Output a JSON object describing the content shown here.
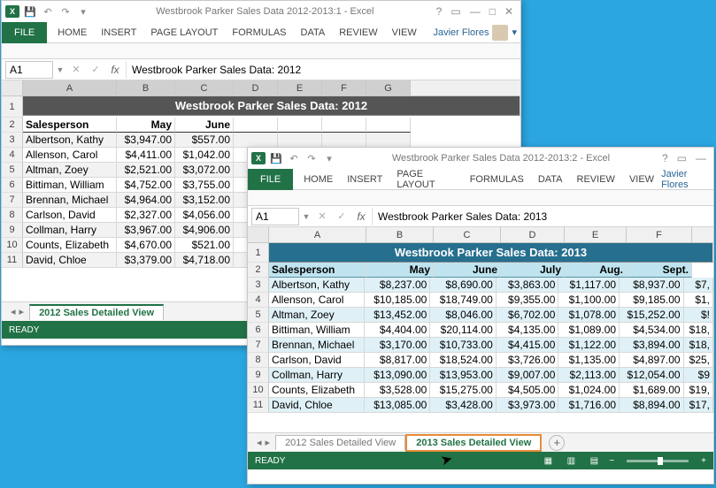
{
  "ribbon": {
    "file": "FILE",
    "tabs": [
      "HOME",
      "INSERT",
      "PAGE LAYOUT",
      "FORMULAS",
      "DATA",
      "REVIEW",
      "VIEW"
    ],
    "user": "Javier Flores"
  },
  "status": {
    "ready": "READY"
  },
  "tabs": {
    "t2012": "2012 Sales Detailed View",
    "t2013": "2013 Sales Detailed View"
  },
  "win1": {
    "title": "Westbrook Parker Sales Data 2012-2013:1 - Excel",
    "namebox": "A1",
    "formula": "Westbrook Parker Sales Data: 2012",
    "colheads": [
      "A",
      "B",
      "C",
      "D",
      "E",
      "F",
      "G"
    ],
    "banner": "Westbrook Parker Sales Data: 2012",
    "headers": [
      "Salesperson",
      "May",
      "June"
    ],
    "rows": [
      {
        "n": "Albertson, Kathy",
        "may": "$3,947.00",
        "jun": "$557.00"
      },
      {
        "n": "Allenson, Carol",
        "may": "$4,411.00",
        "jun": "$1,042.00"
      },
      {
        "n": "Altman, Zoey",
        "may": "$2,521.00",
        "jun": "$3,072.00"
      },
      {
        "n": "Bittiman, William",
        "may": "$4,752.00",
        "jun": "$3,755.00"
      },
      {
        "n": "Brennan, Michael",
        "may": "$4,964.00",
        "jun": "$3,152.00"
      },
      {
        "n": "Carlson, David",
        "may": "$2,327.00",
        "jun": "$4,056.00"
      },
      {
        "n": "Collman, Harry",
        "may": "$3,967.00",
        "jun": "$4,906.00"
      },
      {
        "n": "Counts, Elizabeth",
        "may": "$4,670.00",
        "jun": "$521.00"
      },
      {
        "n": "David, Chloe",
        "may": "$3,379.00",
        "jun": "$4,718.00"
      }
    ]
  },
  "win2": {
    "title": "Westbrook Parker Sales Data 2012-2013:2 - Excel",
    "namebox": "A1",
    "formula": "Westbrook Parker Sales Data: 2013",
    "colheads": [
      "A",
      "B",
      "C",
      "D",
      "E",
      "F"
    ],
    "banner": "Westbrook Parker Sales Data: 2013",
    "headers": [
      "Salesperson",
      "May",
      "June",
      "July",
      "Aug.",
      "Sept."
    ],
    "rows": [
      {
        "n": "Albertson, Kathy",
        "b": "$8,237.00",
        "c": "$8,690.00",
        "d": "$3,863.00",
        "e": "$1,117.00",
        "f": "$8,937.00",
        "g": "$7,"
      },
      {
        "n": "Allenson, Carol",
        "b": "$10,185.00",
        "c": "$18,749.00",
        "d": "$9,355.00",
        "e": "$1,100.00",
        "f": "$9,185.00",
        "g": "$1,"
      },
      {
        "n": "Altman, Zoey",
        "b": "$13,452.00",
        "c": "$8,046.00",
        "d": "$6,702.00",
        "e": "$1,078.00",
        "f": "$15,252.00",
        "g": "$!"
      },
      {
        "n": "Bittiman, William",
        "b": "$4,404.00",
        "c": "$20,114.00",
        "d": "$4,135.00",
        "e": "$1,089.00",
        "f": "$4,534.00",
        "g": "$18,"
      },
      {
        "n": "Brennan, Michael",
        "b": "$3,170.00",
        "c": "$10,733.00",
        "d": "$4,415.00",
        "e": "$1,122.00",
        "f": "$3,894.00",
        "g": "$18,"
      },
      {
        "n": "Carlson, David",
        "b": "$8,817.00",
        "c": "$18,524.00",
        "d": "$3,726.00",
        "e": "$1,135.00",
        "f": "$4,897.00",
        "g": "$25,"
      },
      {
        "n": "Collman, Harry",
        "b": "$13,090.00",
        "c": "$13,953.00",
        "d": "$9,007.00",
        "e": "$2,113.00",
        "f": "$12,054.00",
        "g": "$9"
      },
      {
        "n": "Counts, Elizabeth",
        "b": "$3,528.00",
        "c": "$15,275.00",
        "d": "$4,505.00",
        "e": "$1,024.00",
        "f": "$1,689.00",
        "g": "$19,"
      },
      {
        "n": "David, Chloe",
        "b": "$13,085.00",
        "c": "$3,428.00",
        "d": "$3,973.00",
        "e": "$1,716.00",
        "f": "$8,894.00",
        "g": "$17,"
      }
    ]
  }
}
